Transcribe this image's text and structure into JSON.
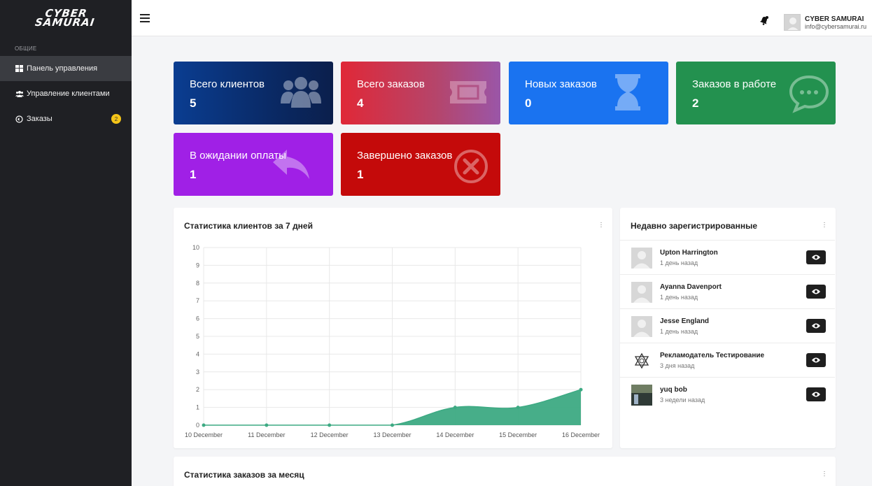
{
  "sidebar": {
    "logo_line1": "CYBER",
    "logo_line2": "SAMURAI",
    "section": "ОБЩИЕ",
    "items": [
      {
        "label": "Панель управления",
        "icon": "dashboard-icon",
        "active": true
      },
      {
        "label": "Управление клиентами",
        "icon": "users-icon"
      },
      {
        "label": "Заказы",
        "icon": "orders-icon",
        "badge": "2"
      }
    ]
  },
  "topbar": {
    "user_name": "CYBER SAMURAI",
    "user_email": "info@cybersamurai.ru"
  },
  "cards": [
    {
      "label": "Всего клиентов",
      "value": "5",
      "icon": "users-icon"
    },
    {
      "label": "Всего заказов",
      "value": "4",
      "icon": "ticket-icon"
    },
    {
      "label": "Новых заказов",
      "value": "0",
      "icon": "hourglass-icon"
    },
    {
      "label": "Заказов в работе",
      "value": "2",
      "icon": "chat-icon"
    },
    {
      "label": "В ожидании оплаты",
      "value": "1",
      "icon": "reply-icon"
    },
    {
      "label": "Завершено заказов",
      "value": "1",
      "icon": "cancel-icon"
    }
  ],
  "colors": {
    "accent_green": "#3daa83",
    "card_blue_dark": "#0b3b8a",
    "card_red": "#dc3545",
    "card_blue": "#1a73f0",
    "card_green": "#23914f",
    "card_purple": "#a020e6",
    "card_darkred": "#c40a0a"
  },
  "clients_chart": {
    "title": "Статистика клиентов за 7 дней"
  },
  "chart_data": {
    "type": "area",
    "title": "Статистика клиентов за 7 дней",
    "categories": [
      "10 December",
      "11 December",
      "12 December",
      "13 December",
      "14 December",
      "15 December",
      "16 December"
    ],
    "values": [
      0,
      0,
      0,
      0,
      1,
      1,
      2
    ],
    "yticks": [
      "0",
      "1",
      "2",
      "3",
      "4",
      "5",
      "6",
      "7",
      "8",
      "9",
      "10"
    ],
    "ylim": [
      0,
      10
    ],
    "grid": true
  },
  "recent": {
    "title": "Недавно зарегистрированные",
    "users": [
      {
        "name": "Upton Harrington",
        "time": "1 день назад"
      },
      {
        "name": "Ayanna Davenport",
        "time": "1 день назад"
      },
      {
        "name": "Jesse England",
        "time": "1 день назад"
      },
      {
        "name": "Рекламодатель Тестирование",
        "time": "3 дня назад"
      },
      {
        "name": "yuq bob",
        "time": "3 недели назад"
      }
    ]
  },
  "orders_chart": {
    "title": "Статистика заказов за месяц"
  }
}
